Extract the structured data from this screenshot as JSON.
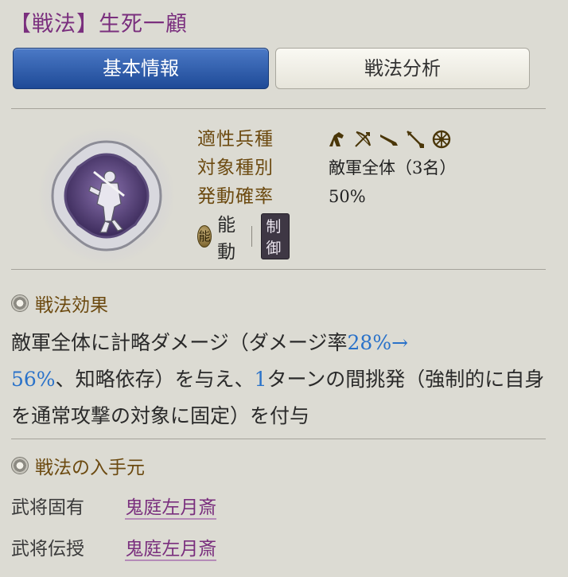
{
  "header": {
    "title": "【戦法】生死一顧"
  },
  "tabs": [
    {
      "label": "基本情報",
      "active": true
    },
    {
      "label": "戦法分析",
      "active": false
    }
  ],
  "properties": {
    "troop_label": "適性兵種",
    "troop_icons": [
      "cavalry-icon",
      "archer-icon",
      "gun-icon",
      "spear-icon",
      "shield-icon"
    ],
    "target_label": "対象種別",
    "target_value": "敵軍全体（3名）",
    "rate_label": "発動確率",
    "rate_value": "50%"
  },
  "activation": {
    "badge_glyph": "能",
    "type": "能動",
    "category": "制御"
  },
  "effect": {
    "heading": "戦法効果",
    "text_1": "敵軍全体に計略ダメージ（ダメージ率",
    "rate_from": "28%",
    "arrow": "→",
    "rate_to": "56%",
    "text_2": "、知略依存）を与え、",
    "turns": "1",
    "text_3": "ターンの間挑発（強制的に自身を通常攻撃の対象に固定）を付与"
  },
  "source": {
    "heading": "戦法の入手元",
    "rows": [
      {
        "label": "武将固有",
        "value": "鬼庭左月斎"
      },
      {
        "label": "武将伝授",
        "value": "鬼庭左月斎"
      }
    ]
  },
  "colors": {
    "title": "#7a2f7e",
    "label": "#6c4a10",
    "highlight": "#2a72c9",
    "active_tab": "#1e4a97"
  }
}
